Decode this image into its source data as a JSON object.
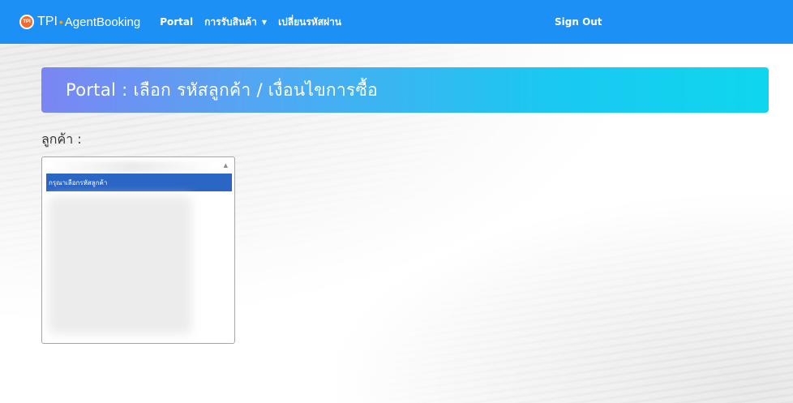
{
  "navbar": {
    "logo_text": "TPI",
    "brand_tpi": "TPI",
    "brand_separator": "•",
    "brand_name": "AgentBooking",
    "items": [
      {
        "label": "Portal"
      },
      {
        "label": "การรับสินค้า",
        "caret": "▼"
      },
      {
        "label": "เปลี่ยนรหัสผ่าน"
      }
    ],
    "sign_out": "Sign Out",
    "background_color": "#1d90f5"
  },
  "banner": {
    "title": "Portal : เลือก รหัสลูกค้า / เงื่อนไขการซื้อ"
  },
  "form": {
    "customer_label": "ลูกค้า :",
    "customer_select": {
      "selected_option": "กรุณาเลือกรหัสลูกค้า",
      "scroll_up_icon": "▲"
    }
  }
}
